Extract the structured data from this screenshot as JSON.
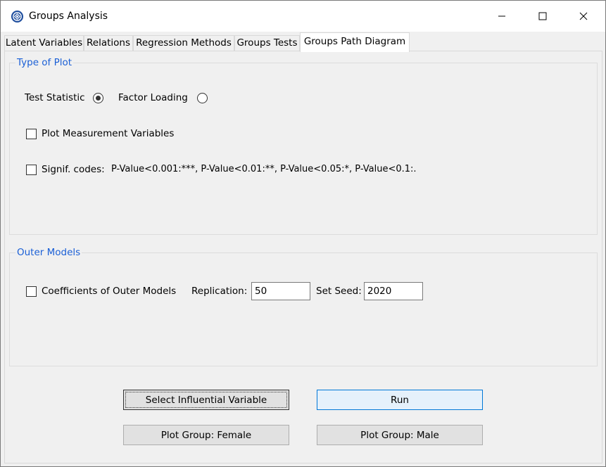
{
  "window": {
    "title": "Groups Analysis"
  },
  "tabs": [
    {
      "label": "Latent Variables"
    },
    {
      "label": "Relations"
    },
    {
      "label": "Regression Methods"
    },
    {
      "label": "Groups Tests"
    },
    {
      "label": "Groups Path Diagram",
      "active": true
    }
  ],
  "type_of_plot": {
    "title": "Type of Plot",
    "radio_test_statistic": {
      "label": "Test Statistic",
      "selected": true
    },
    "radio_factor_loading": {
      "label": "Factor Loading",
      "selected": false
    },
    "plot_measurement_variables": {
      "label": "Plot Measurement Variables",
      "checked": false
    },
    "signif_codes": {
      "label": "Signif. codes:",
      "checked": false,
      "description": "P-Value<0.001:***, P-Value<0.01:**, P-Value<0.05:*, P-Value<0.1:."
    }
  },
  "outer_models": {
    "title": "Outer Models",
    "coefficients": {
      "label": "Coefficients of Outer Models",
      "checked": false
    },
    "replication_label": "Replication:",
    "replication_value": "50",
    "seed_label": "Set Seed:",
    "seed_value": "2020"
  },
  "buttons": {
    "select_influential": "Select Influential Variable",
    "run": "Run",
    "plot_female": "Plot Group: Female",
    "plot_male": "Plot Group: Male"
  },
  "colors": {
    "group_title": "#1a5fd6",
    "primary_border": "#0078d7"
  }
}
